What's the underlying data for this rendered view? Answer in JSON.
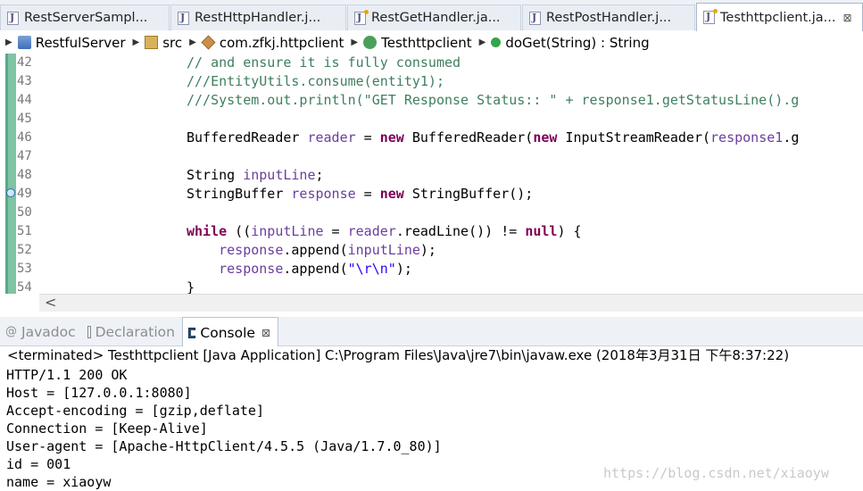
{
  "tabs": [
    {
      "label": "RestServerSampl...",
      "active": false
    },
    {
      "label": "RestHttpHandler.j...",
      "active": false
    },
    {
      "label": "RestGetHandler.ja...",
      "active": false
    },
    {
      "label": "RestPostHandler.j...",
      "active": false
    },
    {
      "label": "Testhttpclient.ja...",
      "active": true
    }
  ],
  "tab_close_glyph": "⊠",
  "breadcrumb": {
    "project": "RestfulServer",
    "src": "src",
    "package": "com.zfkj.httpclient",
    "class": "Testhttpclient",
    "method": "doGet(String) : String"
  },
  "code_lines": [
    {
      "num": "42",
      "parts": [
        {
          "t": "// and ensure it is fully consumed",
          "c": "cmt"
        }
      ]
    },
    {
      "num": "43",
      "parts": [
        {
          "t": "///EntityUtils.consume(entity1);",
          "c": "cmt"
        }
      ]
    },
    {
      "num": "44",
      "parts": [
        {
          "t": "///System.out.println(\"GET Response Status:: \" + response1.getStatusLine().g",
          "c": "cmt"
        }
      ]
    },
    {
      "num": "45",
      "parts": []
    },
    {
      "num": "46",
      "parts": [
        {
          "t": "BufferedReader ",
          "c": "plain"
        },
        {
          "t": "reader",
          "c": "var"
        },
        {
          "t": " = ",
          "c": "plain"
        },
        {
          "t": "new",
          "c": "kw"
        },
        {
          "t": " BufferedReader(",
          "c": "plain"
        },
        {
          "t": "new",
          "c": "kw"
        },
        {
          "t": " InputStreamReader(",
          "c": "plain"
        },
        {
          "t": "response1",
          "c": "var"
        },
        {
          "t": ".g",
          "c": "plain"
        }
      ]
    },
    {
      "num": "47",
      "parts": []
    },
    {
      "num": "48",
      "parts": [
        {
          "t": "String ",
          "c": "plain"
        },
        {
          "t": "inputLine",
          "c": "var"
        },
        {
          "t": ";",
          "c": "plain"
        }
      ]
    },
    {
      "num": "49",
      "parts": [
        {
          "t": "StringBuffer ",
          "c": "plain"
        },
        {
          "t": "response",
          "c": "var"
        },
        {
          "t": " = ",
          "c": "plain"
        },
        {
          "t": "new",
          "c": "kw"
        },
        {
          "t": " StringBuffer();",
          "c": "plain"
        }
      ]
    },
    {
      "num": "50",
      "parts": []
    },
    {
      "num": "51",
      "parts": [
        {
          "t": "while",
          "c": "kw"
        },
        {
          "t": " ((",
          "c": "plain"
        },
        {
          "t": "inputLine",
          "c": "var"
        },
        {
          "t": " = ",
          "c": "plain"
        },
        {
          "t": "reader",
          "c": "var"
        },
        {
          "t": ".readLine()) != ",
          "c": "plain"
        },
        {
          "t": "null",
          "c": "kw"
        },
        {
          "t": ") {",
          "c": "plain"
        }
      ]
    },
    {
      "num": "52",
      "parts": [
        {
          "t": "    ",
          "c": "plain"
        },
        {
          "t": "response",
          "c": "var"
        },
        {
          "t": ".append(",
          "c": "plain"
        },
        {
          "t": "inputLine",
          "c": "var"
        },
        {
          "t": ");",
          "c": "plain"
        }
      ]
    },
    {
      "num": "53",
      "parts": [
        {
          "t": "    ",
          "c": "plain"
        },
        {
          "t": "response",
          "c": "var"
        },
        {
          "t": ".append(",
          "c": "plain"
        },
        {
          "t": "\"\\r\\n\"",
          "c": "str"
        },
        {
          "t": ");",
          "c": "plain"
        }
      ]
    },
    {
      "num": "54",
      "parts": [
        {
          "t": "}",
          "c": "plain"
        }
      ]
    }
  ],
  "scroll_left_glyph": "<",
  "panel_tabs": [
    {
      "label": "Javadoc",
      "icon": "at-icon",
      "glyph": "@",
      "active": false
    },
    {
      "label": "Declaration",
      "icon": "declaration-icon",
      "glyph": "",
      "active": false
    },
    {
      "label": "Console",
      "icon": "console-icon",
      "glyph": "",
      "active": true
    }
  ],
  "console": {
    "status": "<terminated> Testhttpclient [Java Application] C:\\Program Files\\Java\\jre7\\bin\\javaw.exe (2018年3月31日 下午8:37:22)",
    "lines": [
      "HTTP/1.1 200 OK",
      "Host = [127.0.0.1:8080]",
      "Accept-encoding = [gzip,deflate]",
      "Connection = [Keep-Alive]",
      "User-agent = [Apache-HttpClient/4.5.5 (Java/1.7.0_80)]",
      "id = 001",
      "name = xiaoyw"
    ]
  },
  "watermark": "https://blog.csdn.net/xiaoyw"
}
